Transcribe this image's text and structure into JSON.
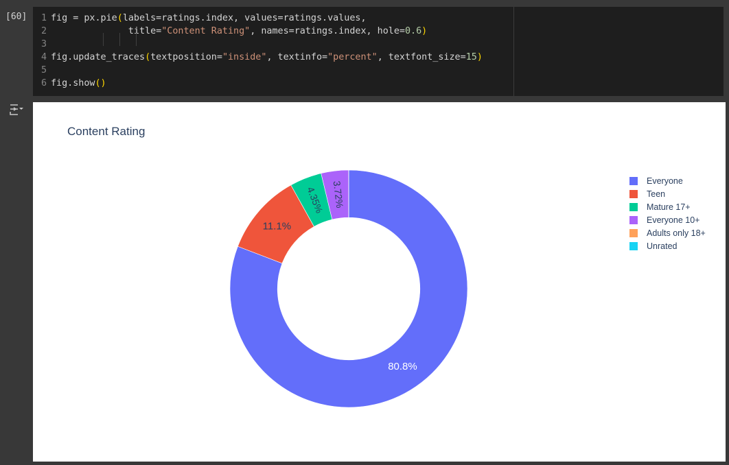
{
  "cell": {
    "execution_count": "[60]",
    "code_lines": [
      {
        "num": "1",
        "tokens": [
          {
            "t": "fig = px.pie",
            "c": ""
          },
          {
            "t": "(",
            "c": "tok-paren"
          },
          {
            "t": "labels=ratings.index, values=ratings.values,",
            "c": ""
          }
        ]
      },
      {
        "num": "2",
        "tokens": [
          {
            "t": "              title=",
            "c": ""
          },
          {
            "t": "\"Content Rating\"",
            "c": "tok-str"
          },
          {
            "t": ", names=ratings.index, hole=",
            "c": ""
          },
          {
            "t": "0.6",
            "c": "tok-num"
          },
          {
            "t": ")",
            "c": "tok-paren"
          }
        ]
      },
      {
        "num": "3",
        "tokens": []
      },
      {
        "num": "4",
        "tokens": [
          {
            "t": "fig.update_traces",
            "c": ""
          },
          {
            "t": "(",
            "c": "tok-paren"
          },
          {
            "t": "textposition=",
            "c": ""
          },
          {
            "t": "\"inside\"",
            "c": "tok-str"
          },
          {
            "t": ", textinfo=",
            "c": ""
          },
          {
            "t": "\"percent\"",
            "c": "tok-str"
          },
          {
            "t": ", textfont_size=",
            "c": ""
          },
          {
            "t": "15",
            "c": "tok-num"
          },
          {
            "t": ")",
            "c": "tok-paren"
          }
        ]
      },
      {
        "num": "5",
        "tokens": []
      },
      {
        "num": "6",
        "tokens": [
          {
            "t": "fig.show",
            "c": ""
          },
          {
            "t": "()",
            "c": "tok-paren"
          }
        ]
      }
    ],
    "output_icon": "output-toggle-icon"
  },
  "chart_data": {
    "type": "pie",
    "title": "Content Rating",
    "hole": 0.6,
    "textinfo": "percent",
    "legend_position": "top-right",
    "slices": [
      {
        "label": "Everyone",
        "percent": 80.8,
        "text": "80.8%",
        "color": "#636efa"
      },
      {
        "label": "Teen",
        "percent": 11.1,
        "text": "11.1%",
        "color": "#ef553b"
      },
      {
        "label": "Mature 17+",
        "percent": 4.35,
        "text": "4.35%",
        "color": "#00cc96"
      },
      {
        "label": "Everyone 10+",
        "percent": 3.72,
        "text": "3.72%",
        "color": "#ab63fa"
      },
      {
        "label": "Adults only 18+",
        "percent": 0.01,
        "text": "",
        "color": "#ffa15a"
      },
      {
        "label": "Unrated",
        "percent": 0.01,
        "text": "",
        "color": "#19d3f3"
      }
    ]
  }
}
